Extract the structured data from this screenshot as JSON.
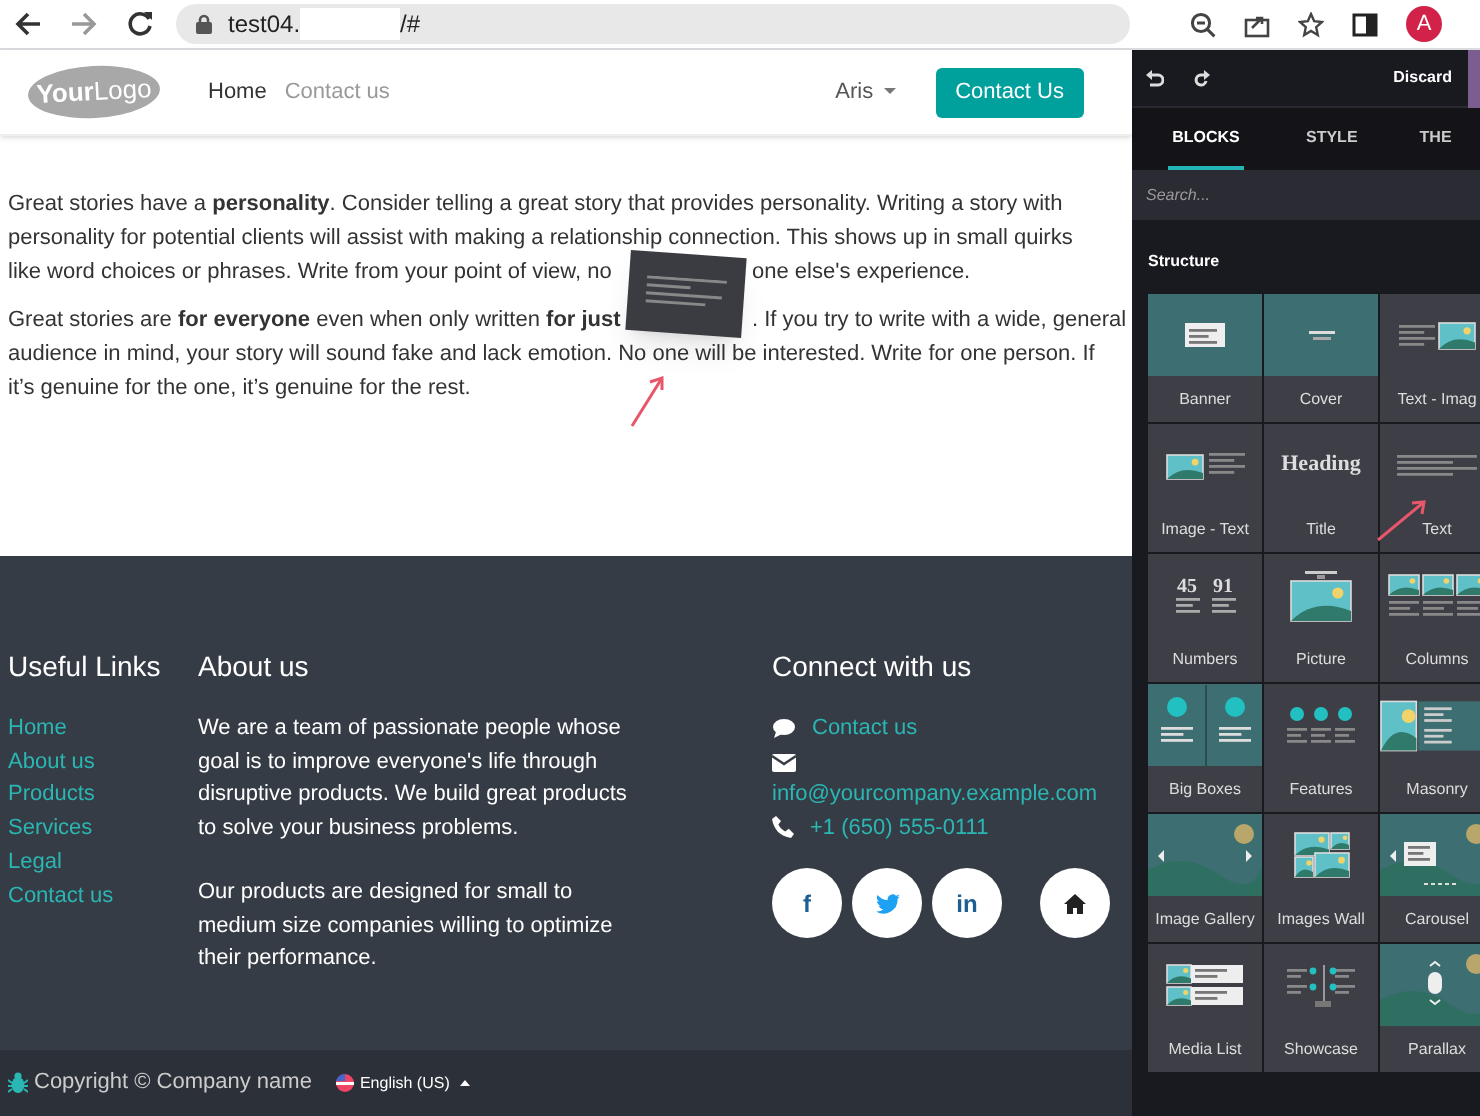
{
  "browser": {
    "url_start": "test04.",
    "url_end": "/#",
    "avatar": "A"
  },
  "header": {
    "logo_bold": "Your",
    "logo_light": "Logo",
    "nav": [
      {
        "label": "Home",
        "selected": true
      },
      {
        "label": "Contact us",
        "selected": false
      }
    ],
    "user": "Aris",
    "cta": "Contact Us"
  },
  "content": {
    "paragraphs": [
      {
        "lines": [
          [
            "Great stories have a **personality**. Consider telling a great story that provides personality. Writing a story with"
          ],
          [
            "personality for potential clients will assist with making a relationship connection. This shows up in small quirks"
          ],
          [
            "like word choices or phrases. Write from your point of view, no",
            "one else's experience."
          ]
        ]
      },
      {
        "lines": [
          [
            "Great stories are **for everyone** even when only written **for just**",
            ". If you try to write with a wide, general"
          ],
          [
            "audience in mind, your story will sound fake and lack emotion. No one will be interested. Write for one person. If"
          ],
          [
            "it’s genuine for the one, it’s genuine for the rest."
          ]
        ]
      }
    ]
  },
  "footer": {
    "useful_links": {
      "title": "Useful Links",
      "links": [
        "Home",
        "About us",
        "Products",
        "Services",
        "Legal",
        "Contact us"
      ]
    },
    "about": {
      "title": "About us",
      "paragraphs": [
        "We are a team of passionate people whose goal is to improve everyone's life through disruptive products. We build great products to solve your business problems.",
        "Our products are designed for small to medium size companies willing to optimize their performance."
      ]
    },
    "connect": {
      "title": "Connect with us",
      "items": [
        {
          "kind": "chat",
          "text": "Contact us"
        },
        {
          "kind": "mail",
          "text": "info@yourcompany.example.com"
        },
        {
          "kind": "phone",
          "text": "+1 (650) 555-0111"
        }
      ],
      "social": [
        {
          "kind": "facebook",
          "glyph": "f"
        },
        {
          "kind": "twitter"
        },
        {
          "kind": "linkedin",
          "glyph": "in"
        },
        {
          "kind": "home"
        }
      ]
    }
  },
  "bottom_bar": {
    "copyright": "Copyright © Company name",
    "language": "English (US)"
  },
  "editor": {
    "discard": "Discard",
    "tabs": [
      {
        "label": "BLOCKS",
        "selected": true
      },
      {
        "label": "STYLE",
        "selected": false
      },
      {
        "label": "THE",
        "selected": false
      }
    ],
    "search": {
      "placeholder": "Search..."
    },
    "section": "Structure",
    "blocks": [
      {
        "label": "Banner",
        "kind": "banner"
      },
      {
        "label": "Cover",
        "kind": "cover"
      },
      {
        "label": "Text - Imag",
        "kind": "text-image"
      },
      {
        "label": "Image - Text",
        "kind": "image-text"
      },
      {
        "label": "Title",
        "kind": "heading",
        "sample": "Heading"
      },
      {
        "label": "Text",
        "kind": "text"
      },
      {
        "label": "Numbers",
        "kind": "numbers",
        "samples": [
          "45",
          "91"
        ]
      },
      {
        "label": "Picture",
        "kind": "picture"
      },
      {
        "label": "Columns",
        "kind": "columns"
      },
      {
        "label": "Big Boxes",
        "kind": "big-boxes"
      },
      {
        "label": "Features",
        "kind": "features"
      },
      {
        "label": "Masonry",
        "kind": "masonry"
      },
      {
        "label": "Image Gallery",
        "kind": "gallery"
      },
      {
        "label": "Images Wall",
        "kind": "images-wall"
      },
      {
        "label": "Carousel",
        "kind": "carousel"
      },
      {
        "label": "Media List",
        "kind": "media-list"
      },
      {
        "label": "Showcase",
        "kind": "showcase"
      },
      {
        "label": "Parallax",
        "kind": "parallax"
      }
    ]
  }
}
